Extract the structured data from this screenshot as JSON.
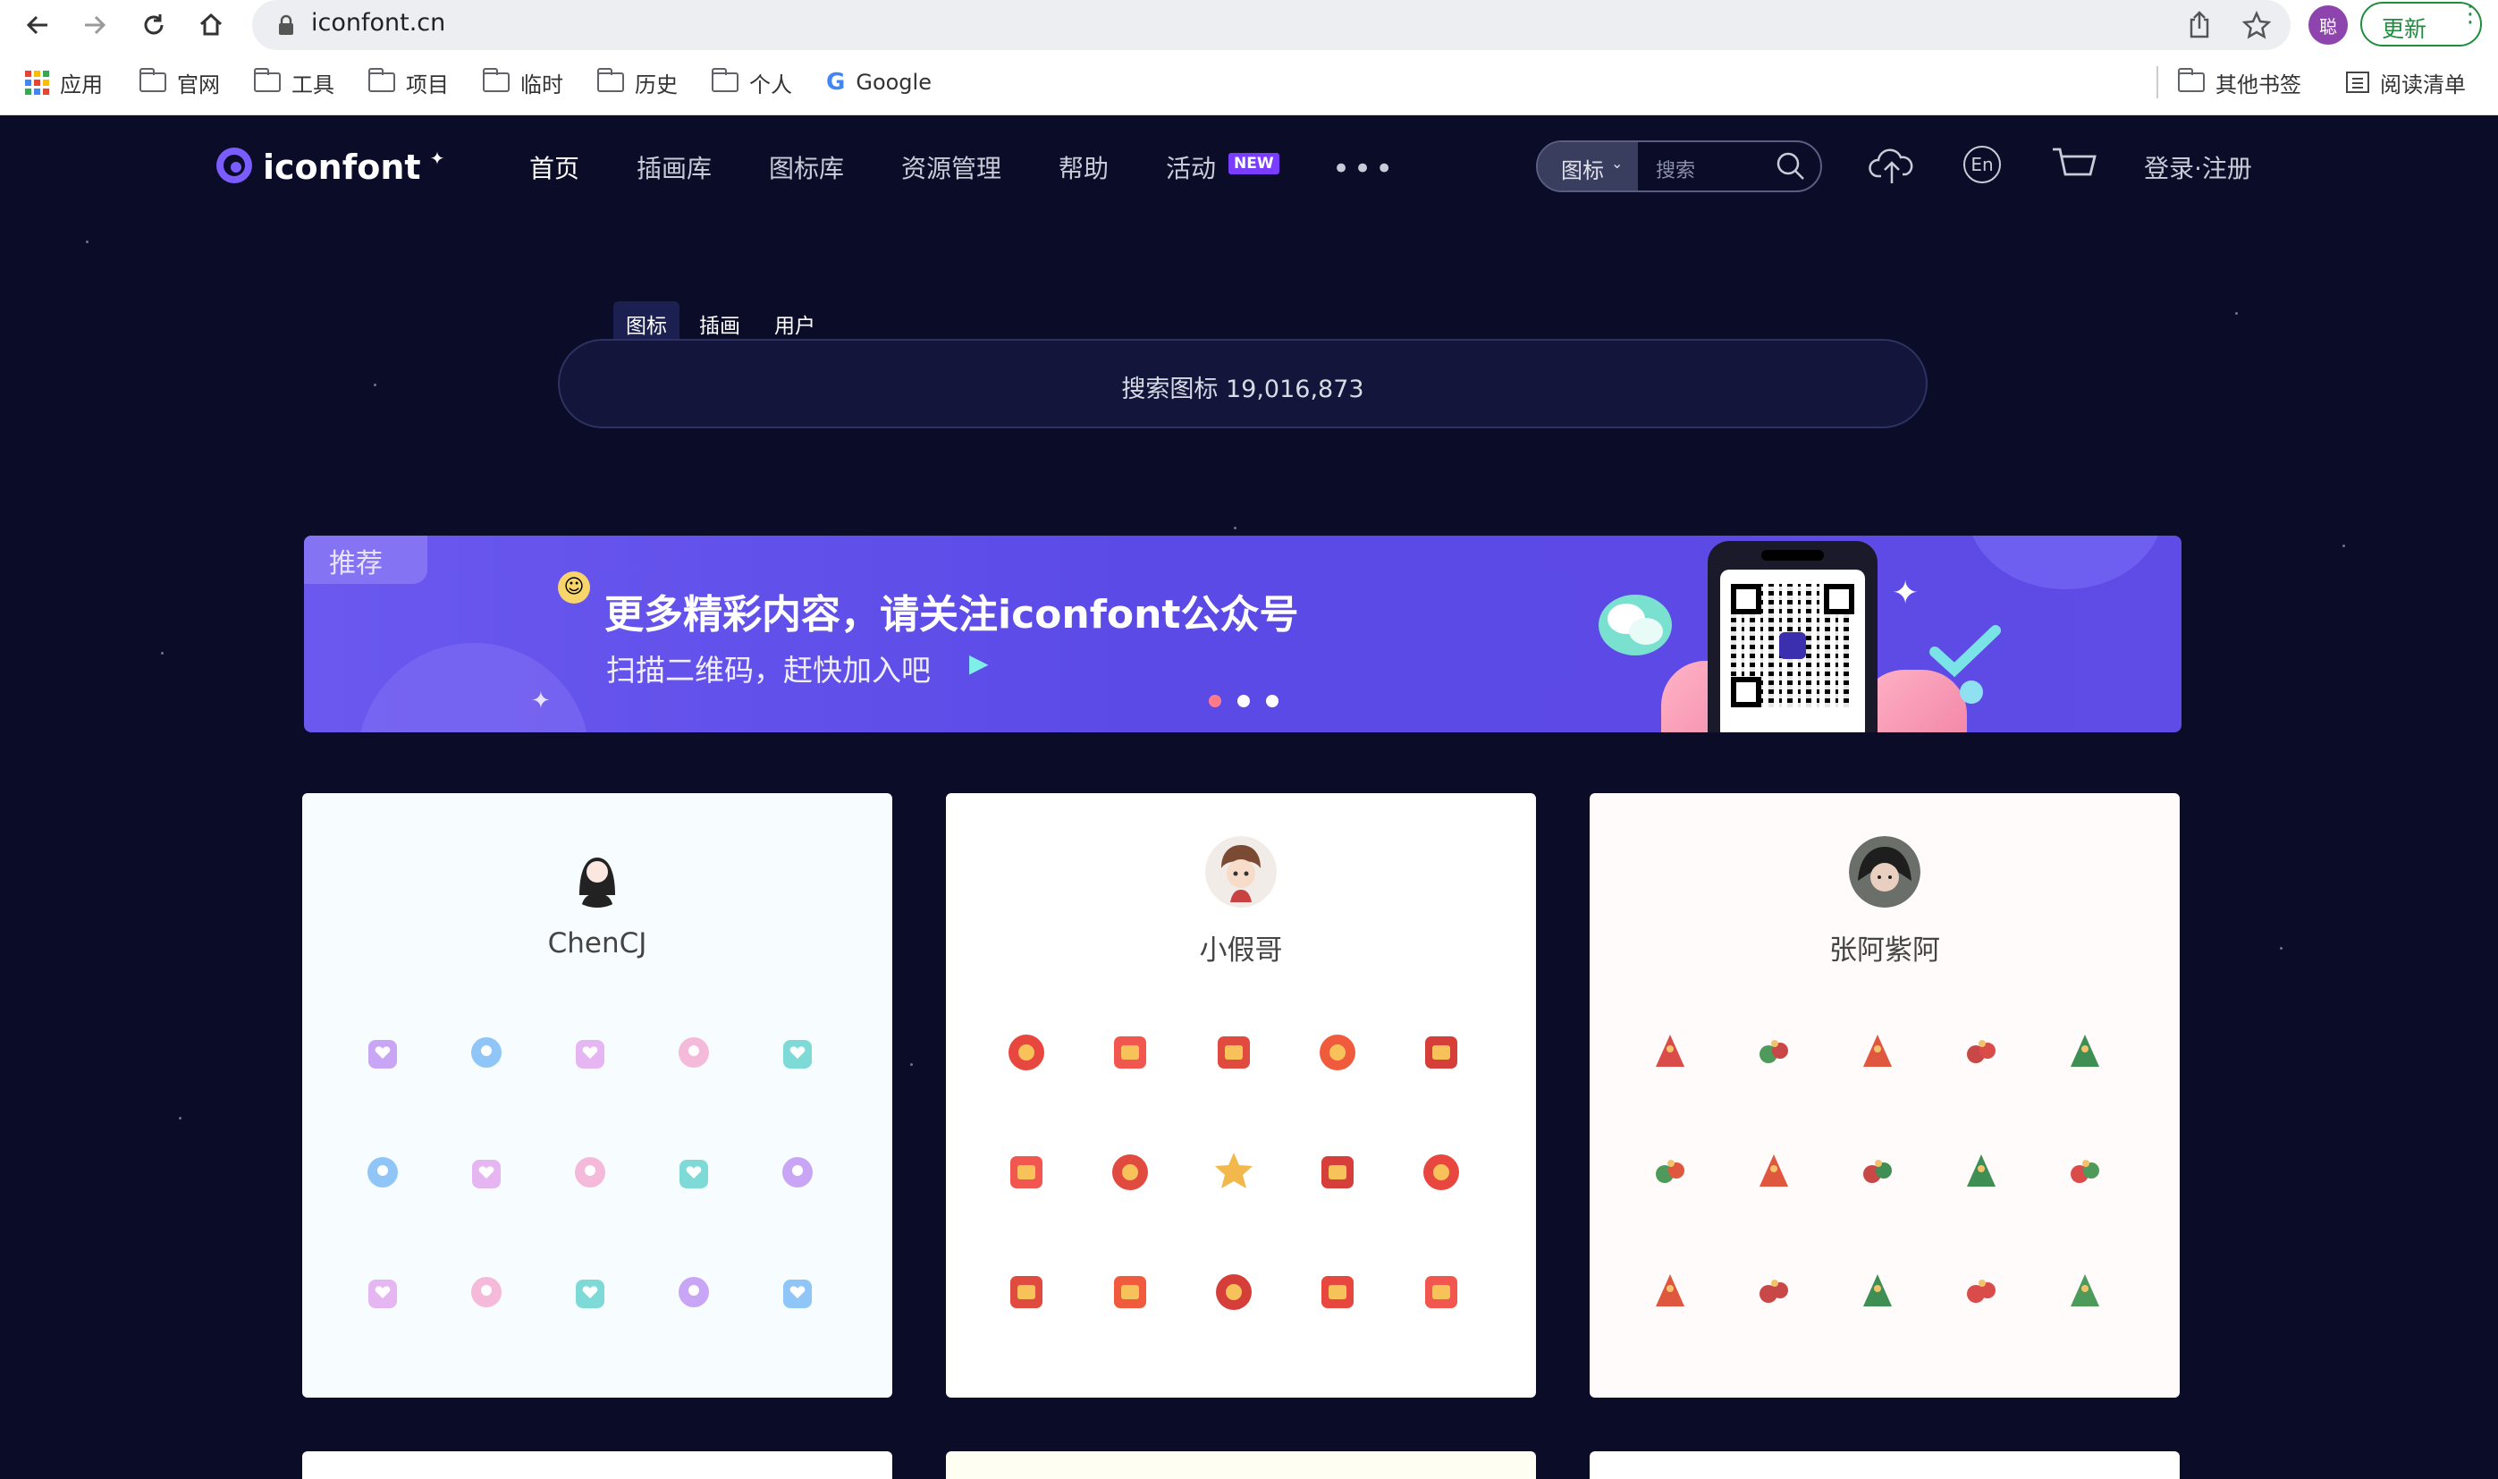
{
  "browser": {
    "url": "iconfont.cn",
    "profile_initial": "聪",
    "update_label": "更新",
    "bookmarks": [
      "应用",
      "官网",
      "工具",
      "项目",
      "临时",
      "历史",
      "个人",
      "Google"
    ],
    "bookmarks_right": [
      "其他书签",
      "阅读清单"
    ]
  },
  "header": {
    "logo_text": "iconfont",
    "nav": [
      "首页",
      "插画库",
      "图标库",
      "资源管理",
      "帮助",
      "活动"
    ],
    "new_badge": "NEW",
    "search_type": "图标",
    "search_placeholder": "搜索",
    "lang": "En",
    "auth": "登录·注册"
  },
  "search": {
    "tabs": [
      "图标",
      "插画",
      "用户"
    ],
    "placeholder": "搜索图标 19,016,873"
  },
  "banner": {
    "tag": "推荐",
    "title": "更多精彩内容，请关注iconfont公众号",
    "subtitle": "扫描二维码，赶快加入吧"
  },
  "cards": [
    {
      "name": "ChenCJ",
      "bg": "#f7fdfe",
      "icons": [
        "palace-icon",
        "teddy-bear-icon",
        "gift-box-icon",
        "champagne-icon",
        "bouquet-icon",
        "crystal-ball-icon",
        "notebook-icon",
        "couple-girl-icon",
        "couple-boy-icon",
        "love-bag-icon",
        "car-icon",
        "love-letter-icon",
        "potted-plant-icon",
        "camera-icon",
        "diamond-ring-icon"
      ]
    },
    {
      "name": "小假哥",
      "bg": "#ffffff",
      "icons": [
        "lantern-icon",
        "red-envelope-icon",
        "firecracker-icon",
        "gift-icon",
        "round-lantern-icon",
        "coin-icon",
        "gift-bag-icon",
        "star-icon",
        "message-icon",
        "envelope-icon",
        "ticket-icon",
        "chinese-knot-icon",
        "fu-diamond-icon",
        "fu-lantern-icon",
        "calendar-icon"
      ]
    },
    {
      "name": "张阿紫阿",
      "bg": "#fefbfa",
      "icons": [
        "holly-icon",
        "candy-cane-icon",
        "berries-icon",
        "snowflake-icon",
        "stocking-icon",
        "bells-icon",
        "ribbon-icon",
        "carrot-icon",
        "snowman-icon",
        "christmas-tree-icon",
        "elf-hat-icon",
        "peppermint-icon",
        "ornament-icon",
        "hot-cocoa-icon",
        "gingerbread-icon"
      ]
    }
  ]
}
